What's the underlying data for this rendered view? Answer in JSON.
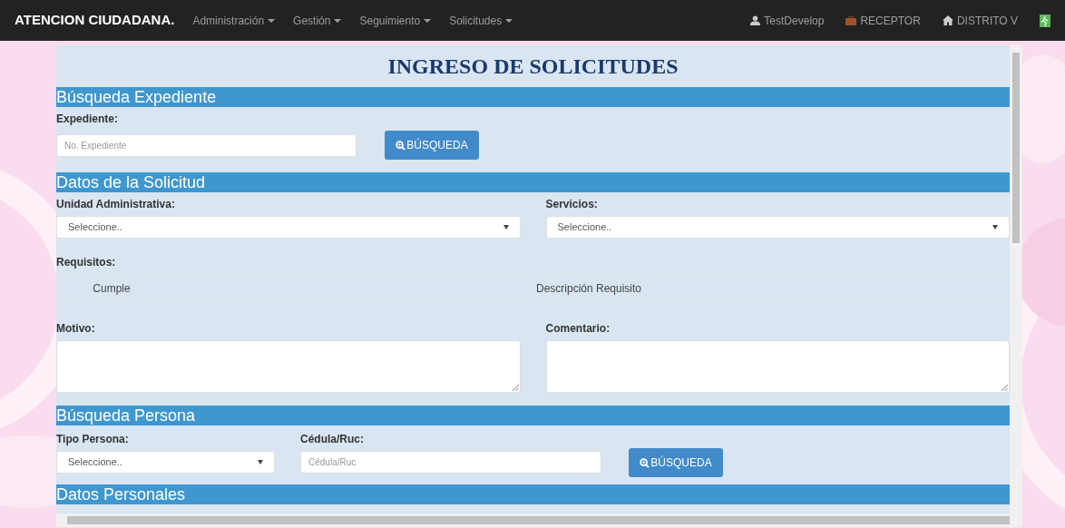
{
  "navbar": {
    "brand": "ATENCION CIUDADANA.",
    "menus": [
      {
        "label": "Administración"
      },
      {
        "label": "Gestión"
      },
      {
        "label": "Seguimiento"
      },
      {
        "label": "Solicitudes"
      }
    ],
    "user_links": [
      {
        "kind": "user",
        "label": "TestDevelop"
      },
      {
        "kind": "role",
        "label": "RECEPTOR"
      },
      {
        "kind": "home",
        "label": "DISTRITO V"
      }
    ]
  },
  "page_title": "INGRESO DE SOLICITUDES",
  "busqueda_expediente": {
    "header": "Búsqueda Expediente",
    "label": "Expediente:",
    "placeholder": "No. Expediente",
    "button": "BÚSQUEDA"
  },
  "datos_solicitud": {
    "header": "Datos de la Solicitud",
    "unidad_label": "Unidad Administrativa:",
    "unidad_value": "Seleccione..",
    "servicios_label": "Servicios:",
    "servicios_value": "Seleccione..",
    "requisitos_label": "Requisitos:",
    "requisitos_columns": [
      "Cumple",
      "Descripción Requisito"
    ],
    "motivo_label": "Motivo:",
    "comentario_label": "Comentario:"
  },
  "busqueda_persona": {
    "header": "Búsqueda Persona",
    "tipo_label": "Tipo Persona:",
    "tipo_value": "Seleccione..",
    "cedula_label": "Cédula/Ruc:",
    "cedula_placeholder": "Cédula/Ruc",
    "button": "BÚSQUEDA"
  },
  "datos_personales": {
    "header": "Datos Personales"
  }
}
